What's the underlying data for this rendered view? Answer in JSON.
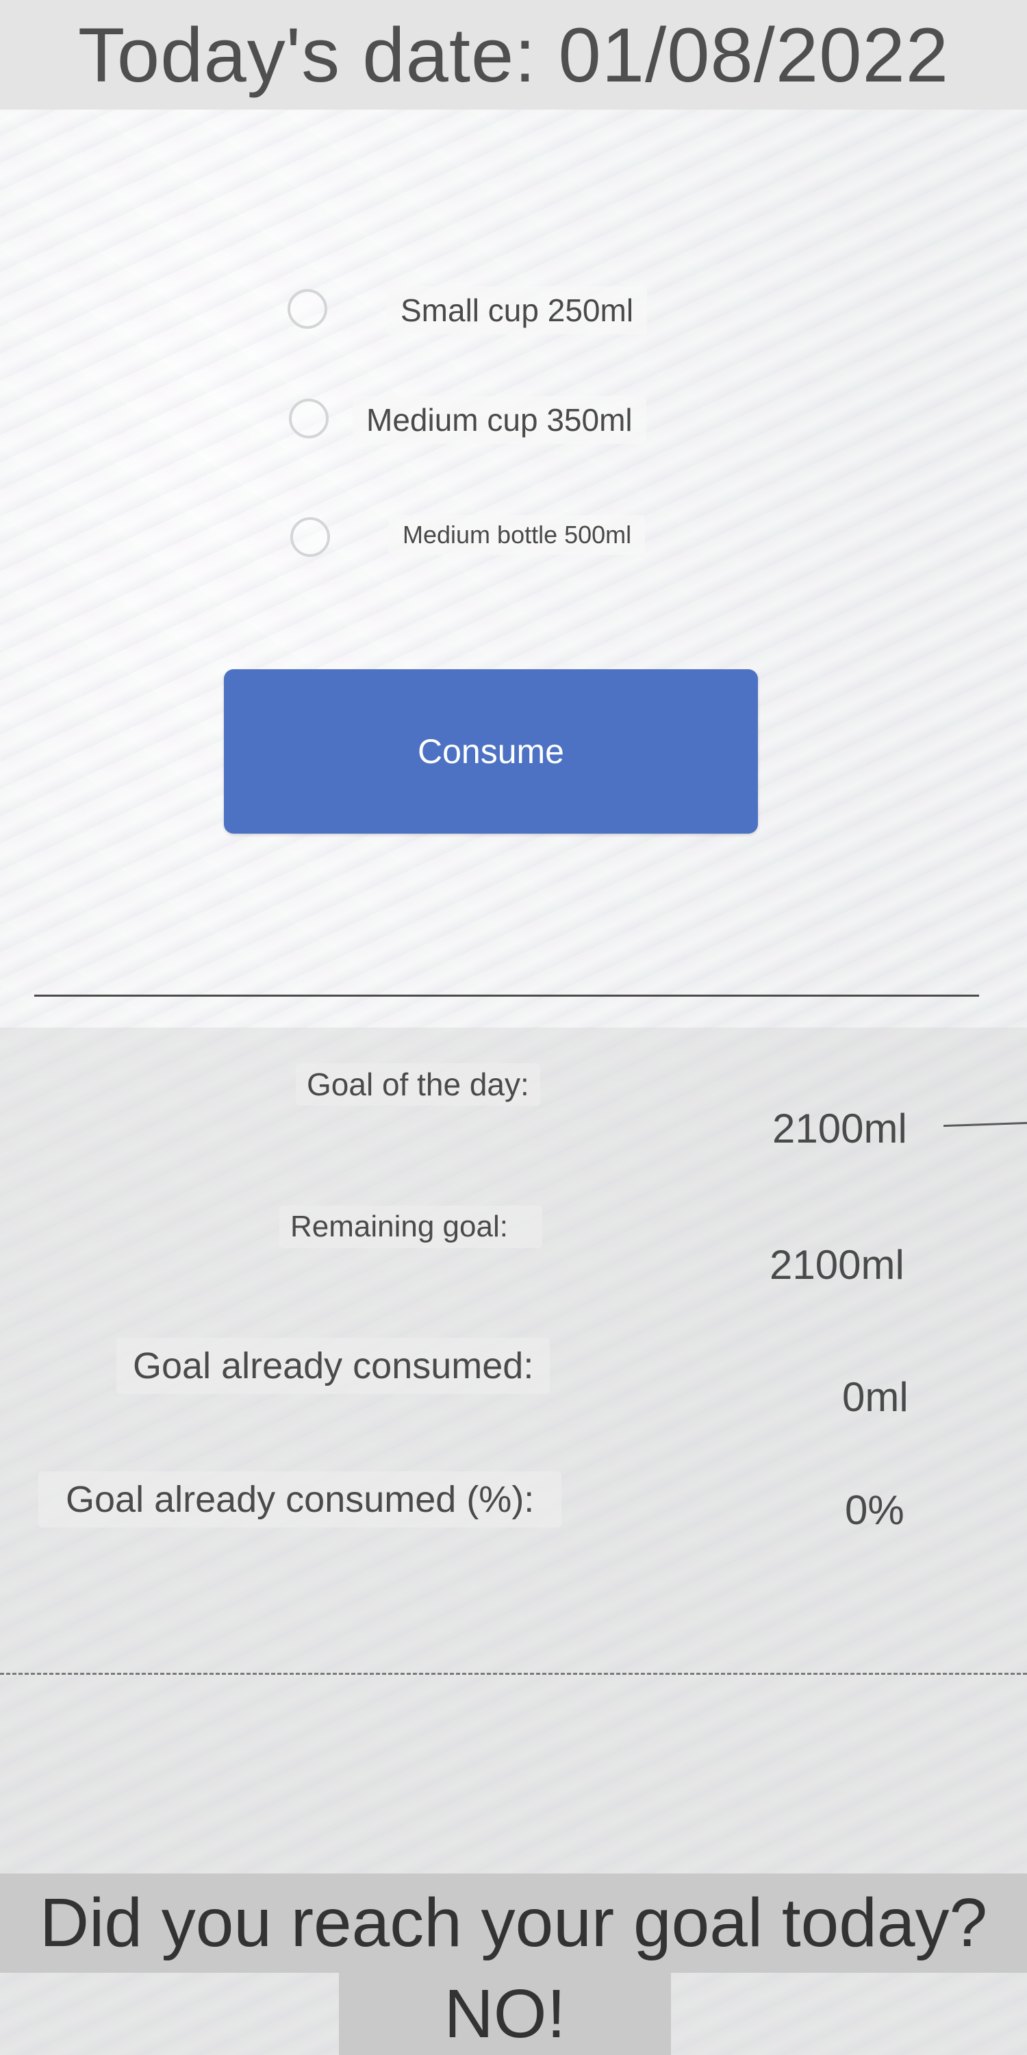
{
  "header": {
    "date_text": "Today's date: 01/08/2022"
  },
  "options": [
    {
      "label": "Small cup 250ml",
      "selected": false
    },
    {
      "label": "Medium cup 350ml",
      "selected": false
    },
    {
      "label": "Medium bottle 500ml",
      "selected": false
    }
  ],
  "consume_button": {
    "label": "Consume",
    "color": "#4d72c4"
  },
  "stats": {
    "goal_of_day": {
      "label": "Goal of the day:",
      "value": "2100ml"
    },
    "remaining_goal": {
      "label": "Remaining goal:",
      "value": "2100ml"
    },
    "goal_consumed": {
      "label": "Goal already consumed:",
      "value": "0ml"
    },
    "goal_consumed_pct": {
      "label": "Goal already consumed (%):",
      "value": "0%"
    }
  },
  "result": {
    "question": "Did you reach your goal today?",
    "answer": "NO!"
  }
}
